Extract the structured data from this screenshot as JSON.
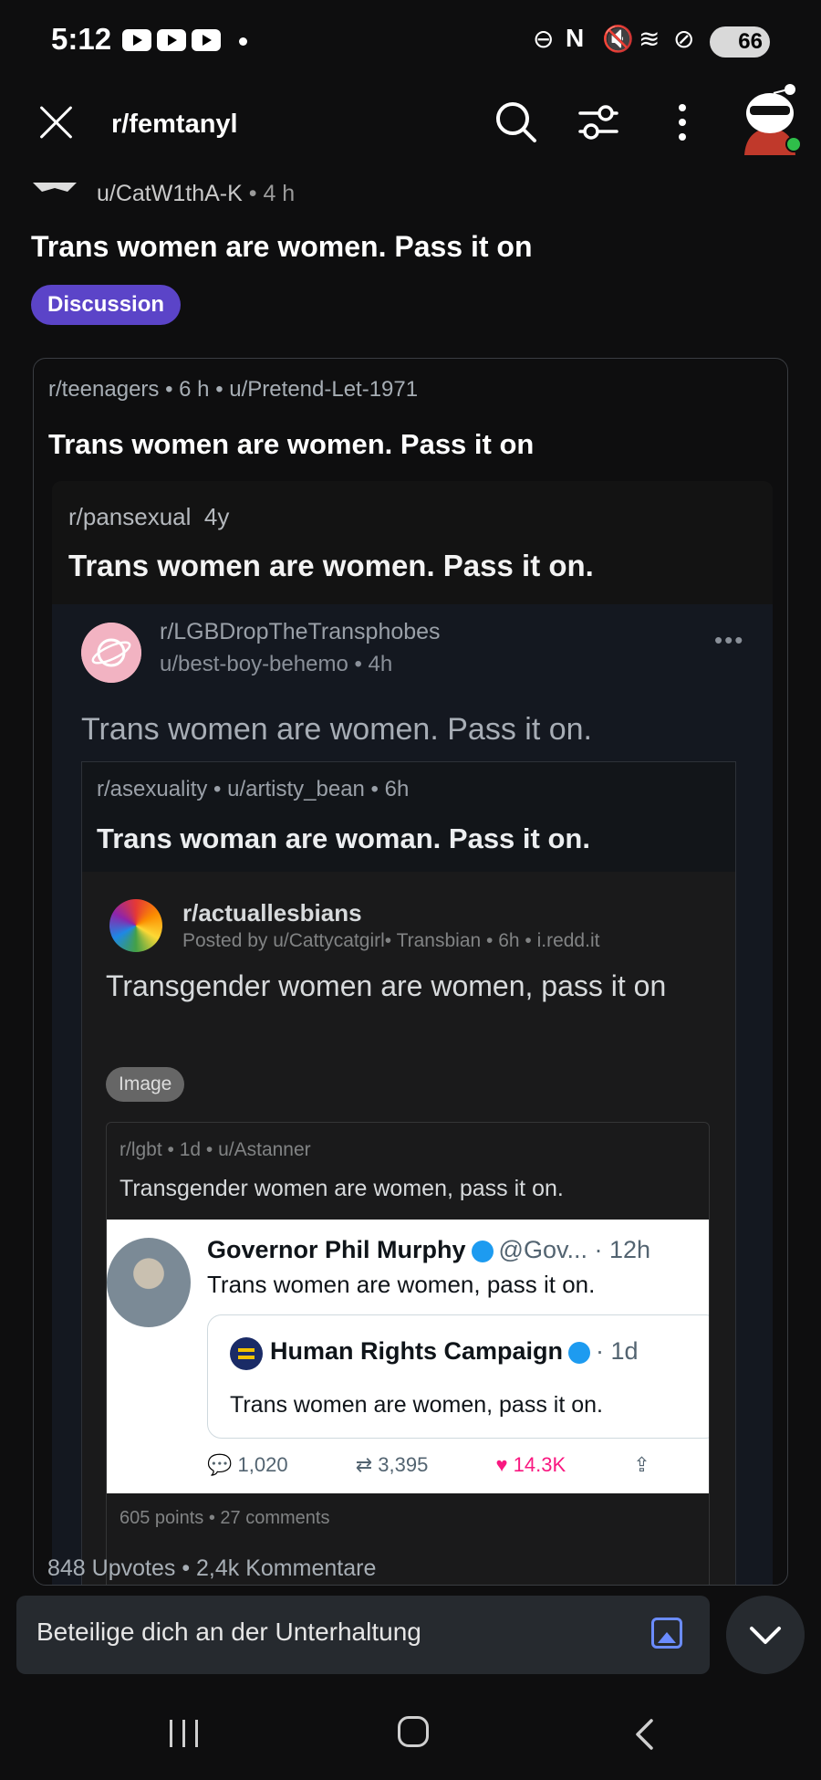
{
  "status_bar": {
    "time": "5:12",
    "battery": "66"
  },
  "header": {
    "subreddit": "r/femtanyl"
  },
  "post": {
    "author": "u/CatW1thA-K",
    "age": "4 h",
    "title": "Trans women are women. Pass it on",
    "flair": "Discussion"
  },
  "crosspost": {
    "subreddit": "r/teenagers",
    "age": "6 h",
    "author": "u/Pretend-Let-1971",
    "title": "Trans women are women. Pass it on"
  },
  "screenshot": {
    "l1": {
      "subreddit": "r/pansexual",
      "age": "4y",
      "title": "Trans women are women. Pass it on."
    },
    "l2": {
      "subreddit": "r/LGBDropTheTransphobes",
      "user_line": "u/best-boy-behemo • 4h",
      "more": "•••",
      "title": "Trans women are women. Pass it on."
    },
    "l3": {
      "meta": "r/asexuality • u/artisty_bean • 6h",
      "title": "Trans woman are woman. Pass it on."
    },
    "l4": {
      "subreddit": "r/actuallesbians",
      "posted": "Posted by u/Cattycatgirl• Transbian • 6h • i.redd.it",
      "title": "Transgender women are women, pass it on",
      "chip": "Image"
    },
    "l5": {
      "meta": "r/lgbt • 1d • u/Astanner",
      "title": "Transgender women are women, pass it on.",
      "footer": "605 points • 27 comments"
    },
    "tweet": {
      "name": "Governor Phil Murphy",
      "handle": "@Gov... · 12h",
      "text": "Trans women are women, pass it on.",
      "quote_name": "Human Rights Campaign",
      "quote_age": "· 1d",
      "quote_text": "Trans women are women, pass it on.",
      "replies": "1,020",
      "retweets": "3,395",
      "likes": "14.3K"
    }
  },
  "footer": {
    "upvotes": "848 Upvotes",
    "comments": "2,4k Kommentare",
    "reply_placeholder": "Beteilige dich an der Unterhaltung"
  },
  "colors": {
    "flair_bg": "#5b44c8",
    "accent_link": "#6b8cff",
    "background": "#0e0e0f"
  }
}
